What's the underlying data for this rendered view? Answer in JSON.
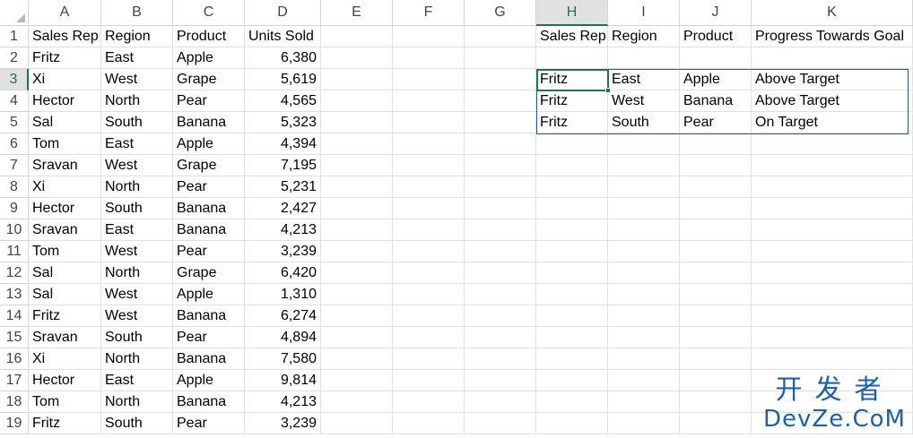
{
  "columns": [
    "A",
    "B",
    "C",
    "D",
    "E",
    "F",
    "G",
    "H",
    "I",
    "J",
    "K"
  ],
  "selected_column": "H",
  "selected_row": 3,
  "rows": [
    {
      "num": "1",
      "A": "Sales Rep",
      "B": "Region",
      "C": "Product",
      "D": "Units Sold",
      "H": "Sales Rep",
      "I": "Region",
      "J": "Product",
      "K": "Progress Towards Goal"
    },
    {
      "num": "2",
      "A": "Fritz",
      "B": "East",
      "C": "Apple",
      "D": "6,380"
    },
    {
      "num": "3",
      "A": "Xi",
      "B": "West",
      "C": "Grape",
      "D": "5,619",
      "H": "Fritz",
      "I": "East",
      "J": "Apple",
      "K": "Above Target"
    },
    {
      "num": "4",
      "A": "Hector",
      "B": "North",
      "C": "Pear",
      "D": "4,565",
      "H": "Fritz",
      "I": "West",
      "J": "Banana",
      "K": "Above Target"
    },
    {
      "num": "5",
      "A": "Sal",
      "B": "South",
      "C": "Banana",
      "D": "5,323",
      "H": "Fritz",
      "I": "South",
      "J": "Pear",
      "K": "On Target"
    },
    {
      "num": "6",
      "A": "Tom",
      "B": "East",
      "C": "Apple",
      "D": "4,394"
    },
    {
      "num": "7",
      "A": "Sravan",
      "B": "West",
      "C": "Grape",
      "D": "7,195"
    },
    {
      "num": "8",
      "A": "Xi",
      "B": "North",
      "C": "Pear",
      "D": "5,231"
    },
    {
      "num": "9",
      "A": "Hector",
      "B": "South",
      "C": "Banana",
      "D": "2,427"
    },
    {
      "num": "10",
      "A": "Sravan",
      "B": "East",
      "C": "Banana",
      "D": "4,213"
    },
    {
      "num": "11",
      "A": "Tom",
      "B": "West",
      "C": "Pear",
      "D": "3,239"
    },
    {
      "num": "12",
      "A": "Sal",
      "B": "North",
      "C": "Grape",
      "D": "6,420"
    },
    {
      "num": "13",
      "A": "Sal",
      "B": "West",
      "C": "Apple",
      "D": "1,310"
    },
    {
      "num": "14",
      "A": "Fritz",
      "B": "West",
      "C": "Banana",
      "D": "6,274"
    },
    {
      "num": "15",
      "A": "Sravan",
      "B": "South",
      "C": "Pear",
      "D": "4,894"
    },
    {
      "num": "16",
      "A": "Xi",
      "B": "North",
      "C": "Banana",
      "D": "7,580"
    },
    {
      "num": "17",
      "A": "Hector",
      "B": "East",
      "C": "Apple",
      "D": "9,814"
    },
    {
      "num": "18",
      "A": "Tom",
      "B": "North",
      "C": "Banana",
      "D": "4,213"
    },
    {
      "num": "19",
      "A": "Fritz",
      "B": "South",
      "C": "Pear",
      "D": "3,239"
    }
  ],
  "numeric_columns": [
    "D"
  ],
  "watermark": {
    "line1": "开发者",
    "line2": "DevZe.CoM"
  },
  "colors": {
    "selection": "#217346",
    "table_border": "#2f5597",
    "watermark": "#1f5fa8"
  }
}
